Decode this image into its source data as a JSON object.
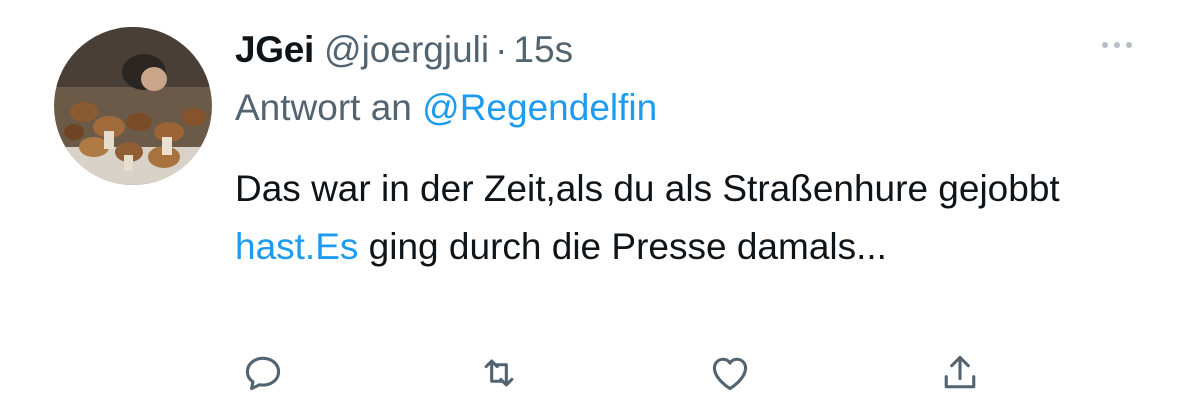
{
  "tweet": {
    "display_name": "JGei",
    "handle": "@joergjuli",
    "separator": "·",
    "time": "15s",
    "reply_prefix": "Antwort an",
    "reply_mention": "@Regendelfin",
    "body_part1": "Das war in der Zeit,als du als Straßenhure gejobbt ",
    "body_link": "hast.Es",
    "body_part2": " ging durch die Presse damals..."
  },
  "icons": {
    "more": "more-icon",
    "reply": "reply-icon",
    "retweet": "retweet-icon",
    "like": "like-icon",
    "share": "share-icon"
  },
  "colors": {
    "text": "#0f1419",
    "secondary": "#536471",
    "accent": "#1d9bf0"
  }
}
